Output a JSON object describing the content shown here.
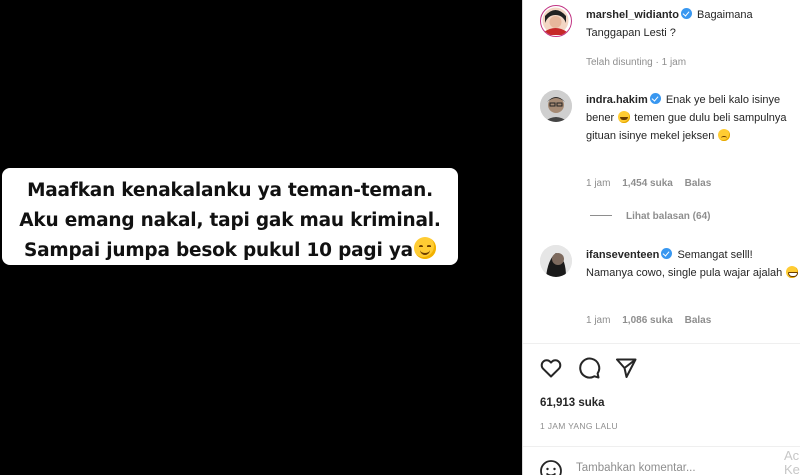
{
  "media": {
    "caption_lines": [
      "Maafkan kenakalanku ya teman-teman.",
      "Aku emang nakal, tapi gak mau kriminal.",
      "Sampai jumpa besok pukul 10 pagi ya"
    ],
    "caption_emoji": "smiling-face-emoji"
  },
  "post": {
    "author": "marshel_widianto",
    "caption": "Bagaimana Tanggapan Lesti ?",
    "edited_label": "Telah disunting",
    "separator": "·",
    "time": "1 jam"
  },
  "comments": [
    {
      "username": "indra.hakim",
      "text_parts": [
        "Enak ye beli kalo isinye bener",
        "temen gue dulu beli sampulnya gituan isinye mekel jeksen"
      ],
      "emojis": [
        "laughing-emoji",
        "sad-emoji"
      ],
      "time": "1 jam",
      "likes": "1,454 suka",
      "reply": "Balas",
      "view_replies": "Lihat balasan (64)"
    },
    {
      "username": "ifanseventeen",
      "text": "Semangat selll! Namanya cowo, single pula wajar ajalah",
      "emojis": [
        "grinning-emoji"
      ],
      "time": "1 jam",
      "likes": "1,086 suka",
      "reply": "Balas"
    }
  ],
  "actions": {
    "like_icon": "heart-icon",
    "comment_icon": "comment-icon",
    "share_icon": "share-icon"
  },
  "stats": {
    "likes": "61,913 suka",
    "time_ago": "1 JAM YANG LALU"
  },
  "comment_input": {
    "placeholder": "Tambahkan komentar...",
    "emoji_icon": "smiley-icon"
  },
  "overlay": {
    "line1": "Ac",
    "line2": "Ke"
  },
  "colors": {
    "verified": "#3897f0",
    "muted": "#8e8e8e",
    "text": "#262626"
  }
}
